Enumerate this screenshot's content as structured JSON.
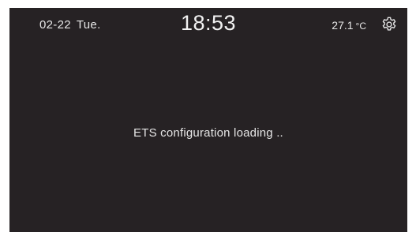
{
  "status_bar": {
    "date": "02-22",
    "weekday": "Tue.",
    "time": "18:53",
    "temperature": "27.1",
    "temperature_unit": "°C",
    "settings_icon": "gear-icon"
  },
  "main": {
    "message": "ETS configuration loading .."
  },
  "colors": {
    "screen_background": "#262224",
    "text": "#e9e9e9",
    "bezel": "#ffffff"
  }
}
